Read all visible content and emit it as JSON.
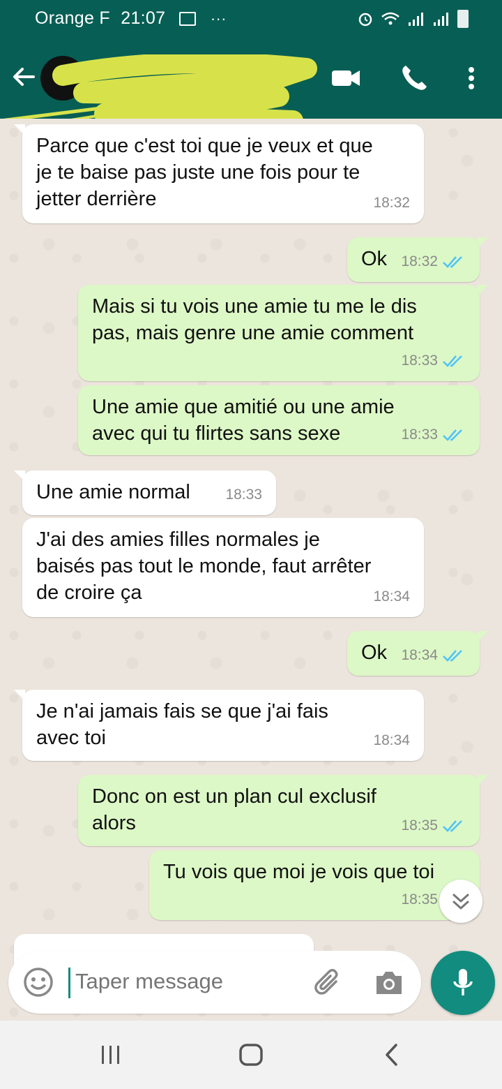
{
  "status_bar": {
    "carrier": "Orange F",
    "time": "21:07",
    "overflow": "···"
  },
  "header": {
    "contact_name": "",
    "icons": [
      "back-arrow-icon",
      "video-call-icon",
      "voice-call-icon",
      "more-options-icon"
    ]
  },
  "messages": [
    {
      "dir": "in",
      "text": "Parce que c'est toi que je veux et que\nje te baise pas juste une fois pour te\njetter derrière",
      "time": "18:32"
    },
    {
      "dir": "out",
      "text": "Ok",
      "time": "18:32",
      "read": true
    },
    {
      "dir": "out",
      "text": "Mais si tu vois une amie tu me le dis\npas, mais genre une amie comment",
      "time": "18:33",
      "read": true
    },
    {
      "dir": "out",
      "text": "Une amie que amitié ou une amie\navec qui tu flirtes sans sexe",
      "time": "18:33",
      "read": true
    },
    {
      "dir": "in",
      "text": "Une amie normal",
      "time": "18:33"
    },
    {
      "dir": "in",
      "text": "J'ai des amies filles normales je\nbaisés pas tout le monde, faut arrêter\nde croire ça",
      "time": "18:34"
    },
    {
      "dir": "out",
      "text": "Ok",
      "time": "18:34",
      "read": true
    },
    {
      "dir": "in",
      "text": "Je n'ai jamais fais se que j'ai fais\navec toi",
      "time": "18:34"
    },
    {
      "dir": "out",
      "text": "Donc on est un plan cul exclusif\nalors",
      "time": "18:35",
      "read": true
    },
    {
      "dir": "out",
      "text": "Tu vois que moi je vois que toi",
      "time": "18:35",
      "read": true
    }
  ],
  "composer": {
    "placeholder": "Taper message"
  },
  "colors": {
    "header": "#075e54",
    "chat_bg": "#ece5dd",
    "outgoing": "#dcf8c6",
    "incoming": "#ffffff",
    "accent": "#128c7e",
    "read_ticks": "#4fc3f7",
    "redaction": "#d7e24a"
  }
}
